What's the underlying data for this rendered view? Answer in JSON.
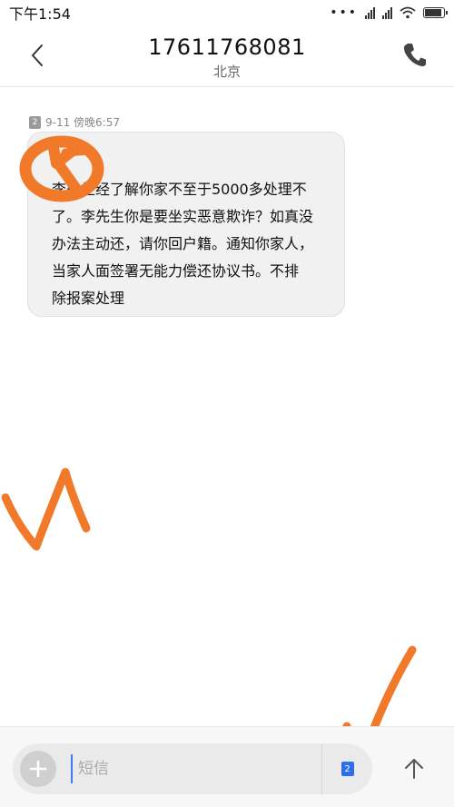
{
  "status_bar": {
    "time": "下午1:54",
    "icons": [
      "more-dots-icon",
      "signal-icon",
      "signal-icon",
      "wifi-icon",
      "battery-icon"
    ]
  },
  "header": {
    "contact_number": "17611768081",
    "contact_location": "北京",
    "back_icon": "chevron-left-icon",
    "call_icon": "phone-icon"
  },
  "message": {
    "sim_slot": "2",
    "timestamp": "9-11 傍晚6:57",
    "body": "李先生经了解你家不至于5000多处理不\n了。李先生你是要坐实恶意欺诈？如真没\n办法主动还，请你回户籍。通知你家人，\n当家人面签署无能力偿还协议书。不排\n除报案处理"
  },
  "composer": {
    "add_icon": "plus-icon",
    "placeholder": "短信",
    "value": "",
    "sim_slot": "2",
    "send_icon": "arrow-up-icon"
  },
  "colors": {
    "accent": "#2d6fe8",
    "scribble": "#f07a2a"
  }
}
